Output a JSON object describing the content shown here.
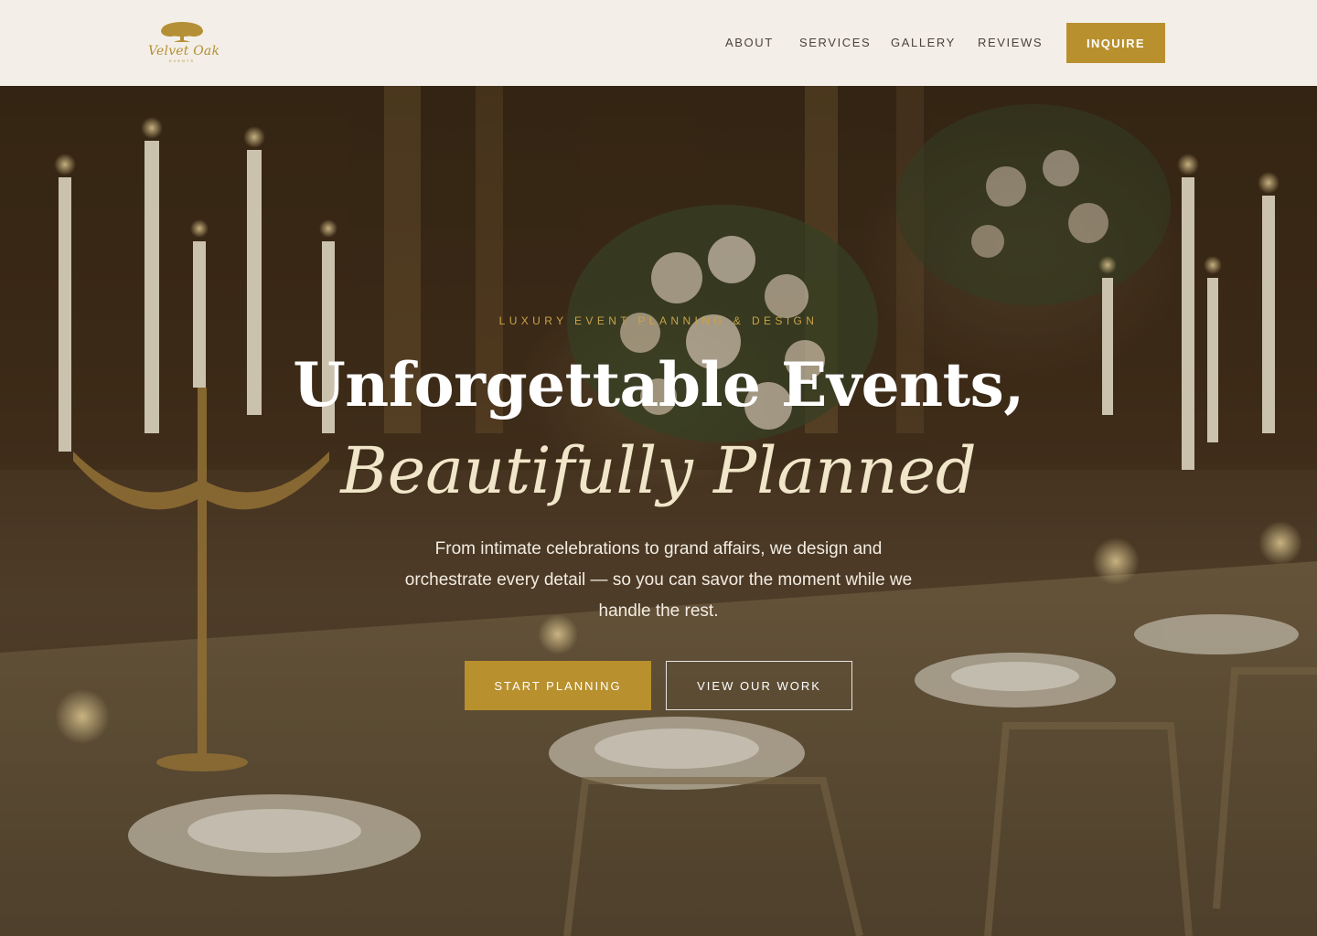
{
  "brand": {
    "name": "Velvet Oak",
    "tagline": "EVENTS"
  },
  "nav": {
    "items": [
      {
        "label": "ABOUT"
      },
      {
        "label": "SERVICES"
      },
      {
        "label": "GALLERY"
      },
      {
        "label": "REVIEWS"
      }
    ],
    "cta_label": "INQUIRE"
  },
  "hero": {
    "eyebrow": "LUXURY EVENT PLANNING & DESIGN",
    "title_line1": "Unforgettable Events,",
    "title_line2": "Beautifully Planned",
    "subtitle": "From intimate celebrations to grand affairs, we design and orchestrate every detail — so you can savor the moment while we handle the rest.",
    "primary_cta": "START PLANNING",
    "secondary_cta": "VIEW OUR WORK",
    "background_description_icon": "candlelit-table-image"
  },
  "colors": {
    "accent": "#b8902e",
    "header_bg": "#f3efe8",
    "eyebrow": "#c9a24a",
    "title": "#ffffff",
    "title_italic": "#f1e6c9"
  }
}
